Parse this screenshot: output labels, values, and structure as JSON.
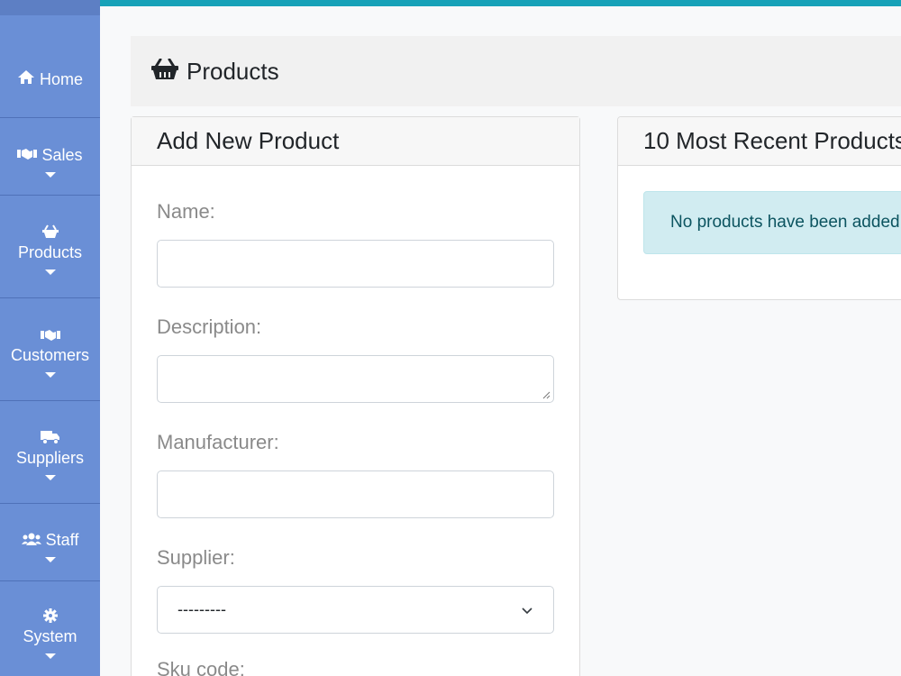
{
  "sidebar": {
    "items": [
      {
        "label": "Home",
        "icon": "home-icon"
      },
      {
        "label": "Sales",
        "icon": "handshake-icon"
      },
      {
        "label": "Products",
        "icon": "basket-icon"
      },
      {
        "label": "Customers",
        "icon": "handshake-icon"
      },
      {
        "label": "Suppliers",
        "icon": "truck-icon"
      },
      {
        "label": "Staff",
        "icon": "users-icon"
      },
      {
        "label": "System",
        "icon": "gear-icon"
      }
    ]
  },
  "header": {
    "title": "Products",
    "icon": "basket-icon"
  },
  "add_form": {
    "title": "Add New Product",
    "name_label": "Name:",
    "name_value": "",
    "description_label": "Description:",
    "description_value": "",
    "manufacturer_label": "Manufacturer:",
    "manufacturer_value": "",
    "supplier_label": "Supplier:",
    "supplier_selected": "---------",
    "sku_label": "Sku code:"
  },
  "recent": {
    "title": "10 Most Recent Products",
    "empty_message": "No products have been added"
  },
  "colors": {
    "sidebar": "#6a8fd6",
    "topbar": "#17a2b8",
    "alert_bg": "#d1ecf1",
    "alert_text": "#0c5460"
  }
}
